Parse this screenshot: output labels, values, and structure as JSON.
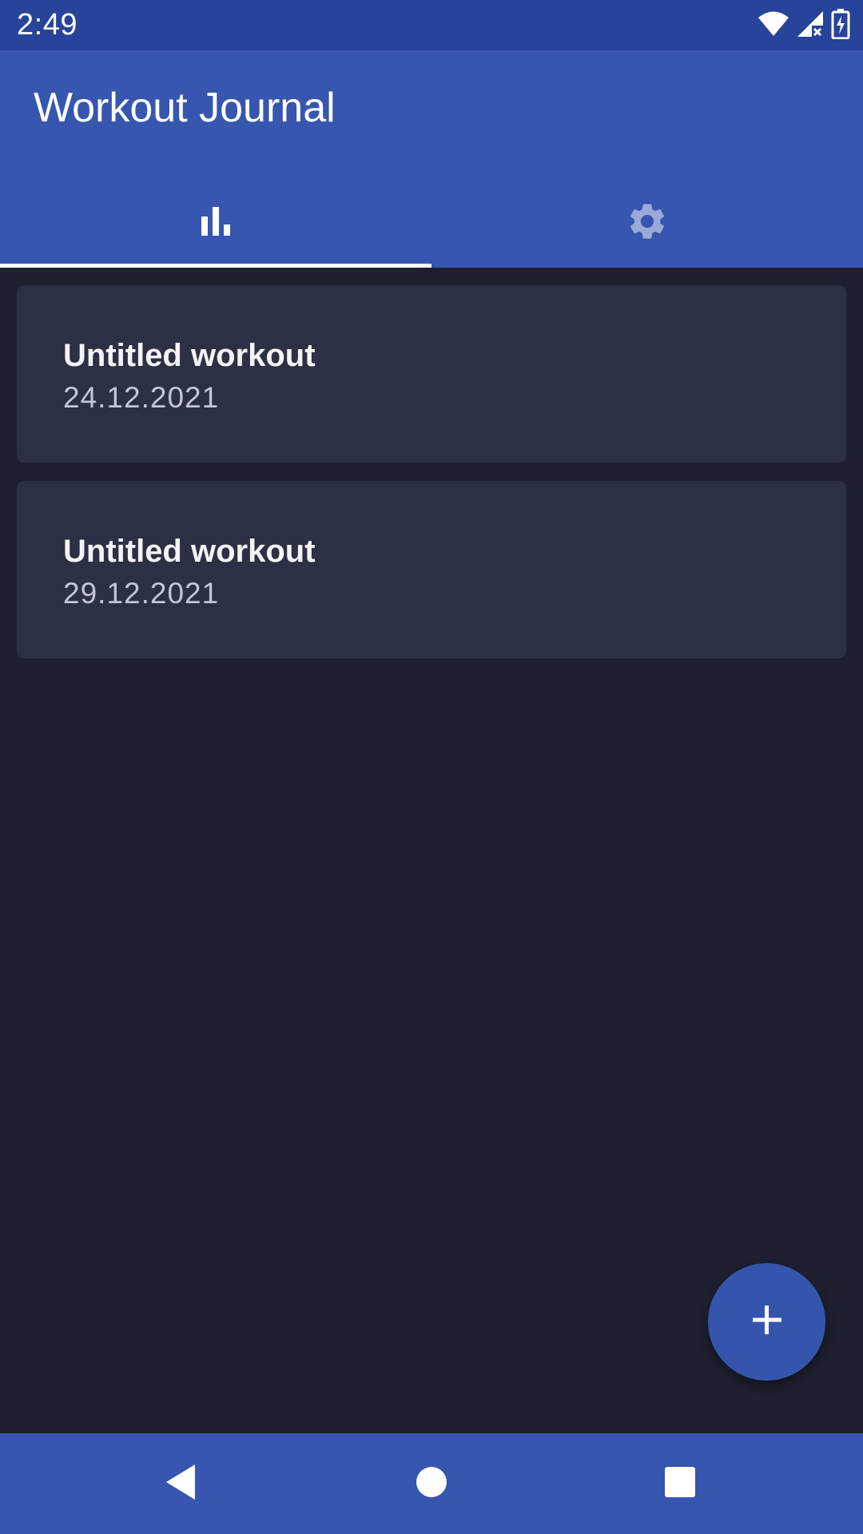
{
  "status_bar": {
    "time": "2:49",
    "icons": [
      "wifi-icon",
      "signal-icon",
      "battery-charging-icon"
    ]
  },
  "app_bar": {
    "title": "Workout Journal",
    "tabs": [
      {
        "icon": "bar-chart-icon",
        "selected": true
      },
      {
        "icon": "gear-icon",
        "selected": false
      }
    ]
  },
  "workouts": [
    {
      "title": "Untitled workout",
      "date": "24.12.2021"
    },
    {
      "title": "Untitled workout",
      "date": "29.12.2021"
    }
  ],
  "fab": {
    "icon": "plus-icon"
  },
  "nav_bar": {
    "buttons": [
      "back-icon",
      "home-icon",
      "recents-icon"
    ]
  },
  "colors": {
    "status_bar": "#27449a",
    "app_bar": "#3656af",
    "background": "#1e2030",
    "card": "#2c3043",
    "fab": "#3555ad"
  }
}
